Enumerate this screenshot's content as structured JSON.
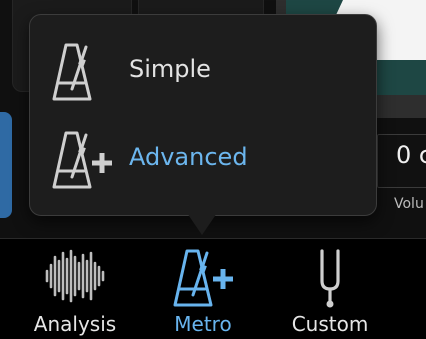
{
  "background": {
    "display_value": "0 c",
    "volume_label": "Volu"
  },
  "popup": {
    "items": [
      {
        "label": "Simple",
        "icon": "metronome-icon",
        "selected": false
      },
      {
        "label": "Advanced",
        "icon": "metronome-plus-icon",
        "selected": true
      }
    ]
  },
  "tabbar": {
    "tabs": [
      {
        "label": "Analysis",
        "icon": "waveform-icon",
        "active": false
      },
      {
        "label": "Metro",
        "icon": "metronome-plus-icon",
        "active": true
      },
      {
        "label": "Custom",
        "icon": "tuning-fork-icon",
        "active": false
      }
    ]
  },
  "colors": {
    "accent": "#68b4ee",
    "background": "#101010",
    "popup": "#1d1d1d",
    "text": "#e6e6e6"
  }
}
